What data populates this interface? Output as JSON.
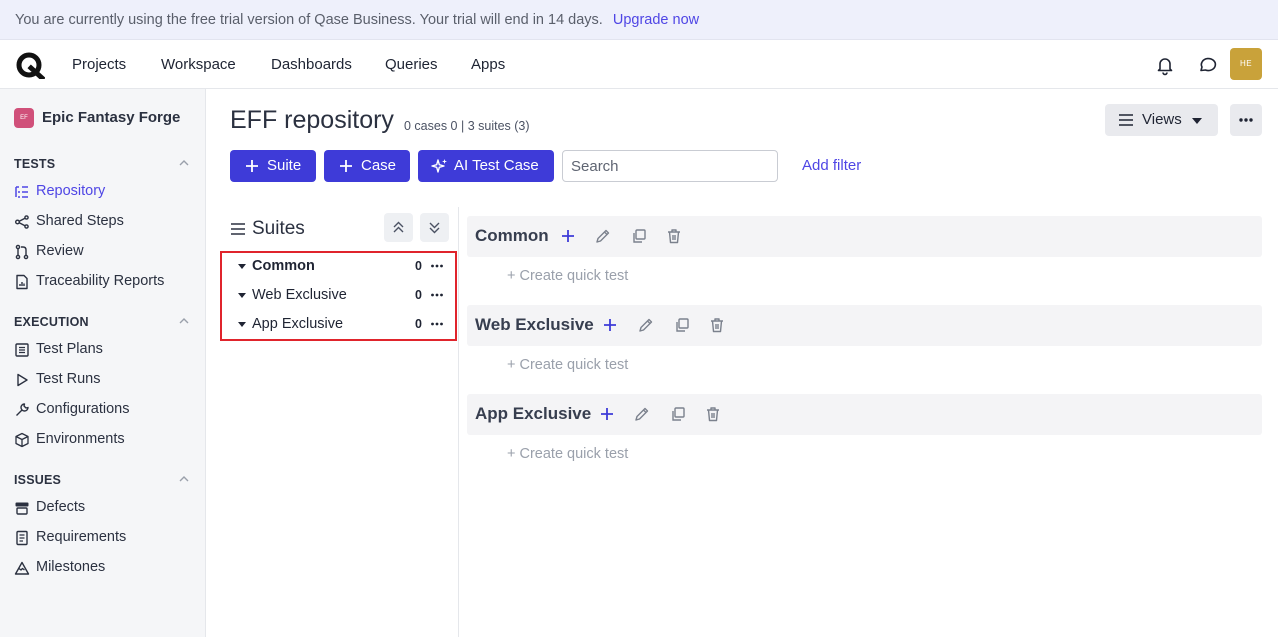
{
  "banner": {
    "text": "You are currently using the free trial version of Qase Business.  Your trial will end in 14 days.",
    "link": "Upgrade now"
  },
  "nav": {
    "items": [
      "Projects",
      "Workspace",
      "Dashboards",
      "Queries",
      "Apps"
    ],
    "avatar_initials": "HE"
  },
  "sidebar": {
    "project_badge": "EF",
    "project_name": "Epic Fantasy Forge",
    "sections": [
      {
        "title": "TESTS",
        "items": [
          "Repository",
          "Shared Steps",
          "Review",
          "Traceability Reports"
        ]
      },
      {
        "title": "EXECUTION",
        "items": [
          "Test Plans",
          "Test Runs",
          "Configurations",
          "Environments"
        ]
      },
      {
        "title": "ISSUES",
        "items": [
          "Defects",
          "Requirements",
          "Milestones"
        ]
      }
    ],
    "active_item": "Repository"
  },
  "main": {
    "title": "EFF repository",
    "counts": "0 cases 0 | 3 suites (3)",
    "views_label": "Views",
    "buttons": {
      "suite": "Suite",
      "case": "Case",
      "ai": "AI Test Case"
    },
    "search_placeholder": "Search",
    "add_filter": "Add filter"
  },
  "suites_panel": {
    "title": "Suites",
    "tree": [
      {
        "name": "Common",
        "count": "0"
      },
      {
        "name": "Web Exclusive",
        "count": "0"
      },
      {
        "name": "App Exclusive",
        "count": "0"
      }
    ]
  },
  "suite_blocks": [
    {
      "name": "Common",
      "quick": "+ Create quick test"
    },
    {
      "name": "Web Exclusive",
      "quick": "+ Create quick test"
    },
    {
      "name": "App Exclusive",
      "quick": "+ Create quick test"
    }
  ],
  "colors": {
    "primary": "#3e3bd8",
    "link": "#4f46e5",
    "highlight_border": "#e0242c",
    "avatar": "#c9a23a",
    "project_badge": "#d0507a"
  }
}
